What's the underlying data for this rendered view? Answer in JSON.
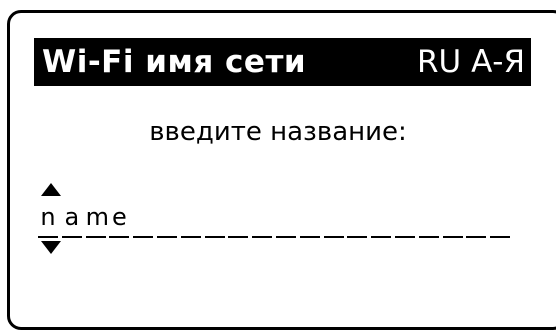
{
  "title": {
    "label": "Wi-Fi имя сети",
    "layout": "RU А-Я"
  },
  "prompt": "введите название:",
  "name_field": {
    "value": "name",
    "characters": [
      "n",
      "a",
      "m",
      "e",
      "",
      "",
      "",
      "",
      "",
      "",
      "",
      "",
      "",
      "",
      "",
      "",
      "",
      "",
      "",
      ""
    ],
    "cursor_index": 0
  },
  "icons": {
    "up": "arrow-up-icon",
    "down": "arrow-down-icon"
  },
  "colors": {
    "foreground": "#000000",
    "background": "#ffffff"
  }
}
